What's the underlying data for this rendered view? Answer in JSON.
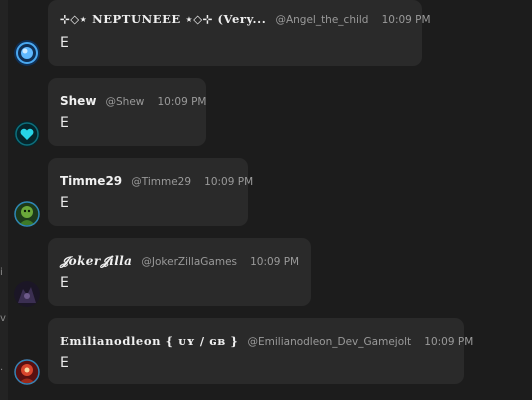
{
  "edge": {
    "glyphs": [
      "i",
      "v",
      "·"
    ]
  },
  "messages": [
    {
      "display_name": "⊹◇⋆ 𝐍𝐄𝐏𝐓𝐔𝐍𝐄𝐄𝐄 ⋆◇⊹ (Very...",
      "handle": "@Angel_the_child",
      "time": "10:09 PM",
      "text": "E",
      "avatar_icon": "blue-planet-avatar"
    },
    {
      "display_name": "Shew",
      "handle": "@Shew",
      "time": "10:09 PM",
      "text": "E",
      "avatar_icon": "cyan-heart-avatar"
    },
    {
      "display_name": "Timme29",
      "handle": "@Timme29",
      "time": "10:09 PM",
      "text": "E",
      "avatar_icon": "green-character-avatar"
    },
    {
      "display_name": "𝓙𝒐𝒌𝒆𝒓𝓙𝒊𝒍𝒍𝒂",
      "handle": "@JokerZillaGames",
      "time": "10:09 PM",
      "text": "E",
      "avatar_icon": "dark-purple-avatar",
      "badge": "crown-icon"
    },
    {
      "display_name": "𝐄𝐦𝐢𝐥𝐢𝐚𝐧𝐨𝐝𝐥𝐞𝐨𝐧 { ᴜʏ / ɢʙ }",
      "handle": "@Emilianodleon_Dev_Gamejolt",
      "time": "10:09 PM",
      "text": "E",
      "avatar_icon": "red-character-avatar"
    }
  ],
  "colors": {
    "background": "#1c1c1c",
    "bubble": "#2a2a2a",
    "muted_text": "#9a9a9a",
    "crown": "#3fc6e0"
  }
}
